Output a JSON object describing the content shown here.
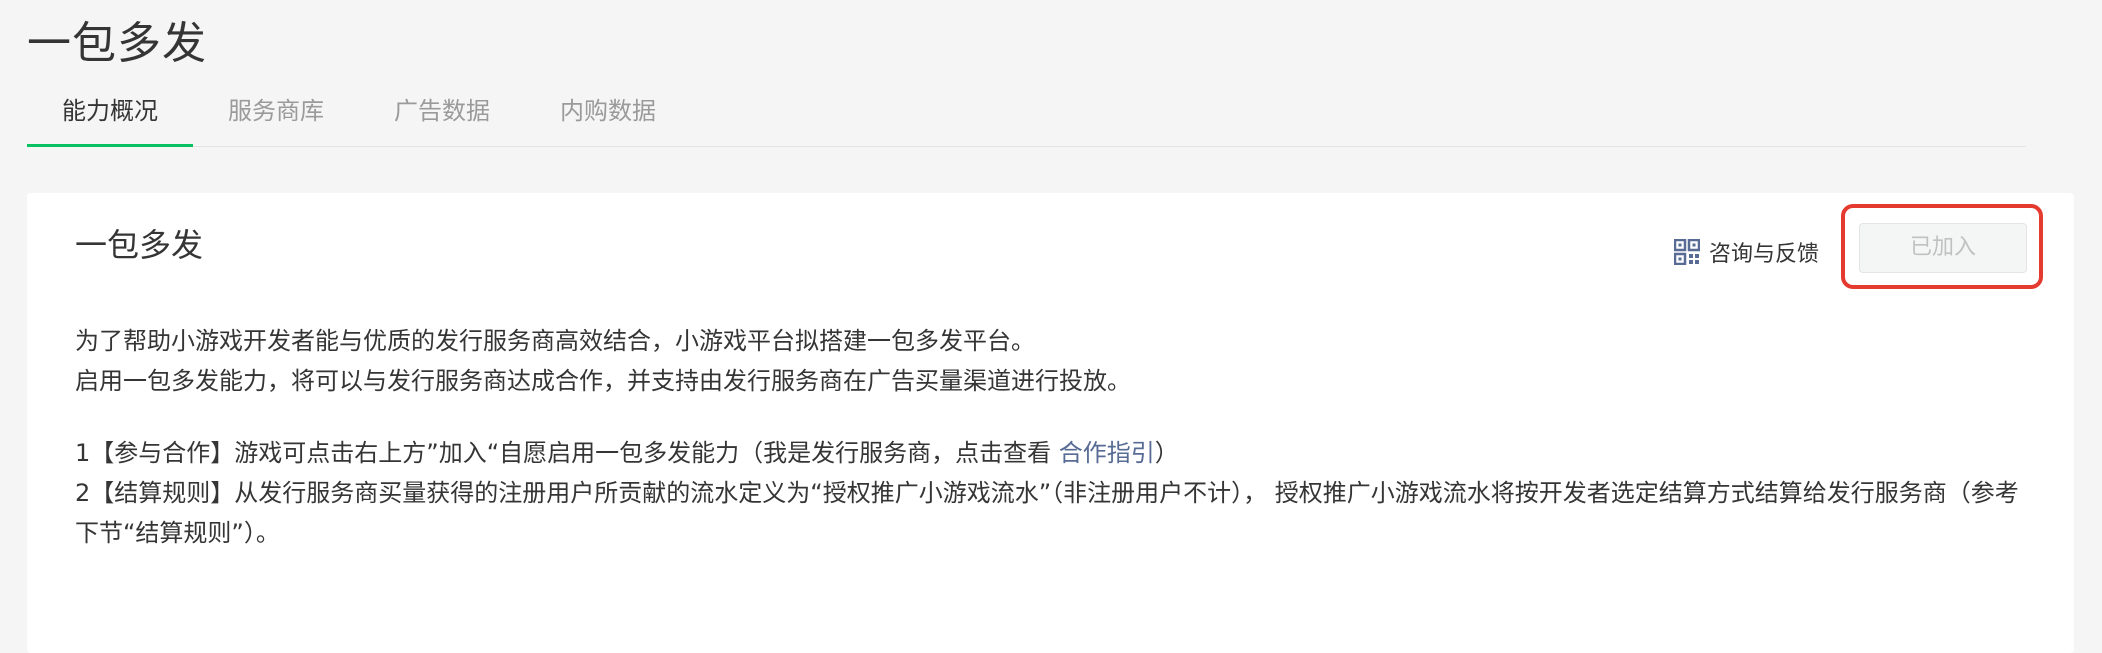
{
  "page": {
    "title": "一包多发"
  },
  "tabs": [
    {
      "label": "能力概况",
      "active": true
    },
    {
      "label": "服务商库",
      "active": false
    },
    {
      "label": "广告数据",
      "active": false
    },
    {
      "label": "内购数据",
      "active": false
    }
  ],
  "card": {
    "title": "一包多发",
    "feedback_label": "咨询与反馈",
    "feedback_icon": "qr-code-icon",
    "joined_button_label": "已加入",
    "intro_line1": "为了帮助小游戏开发者能与优质的发行服务商高效结合，小游戏平台拟搭建一包多发平台。",
    "intro_line2": "启用一包多发能力，将可以与发行服务商达成合作，并支持由发行服务商在广告买量渠道进行投放。",
    "rule1_text": "1【参与合作】游戏可点击右上方”加入“自愿启用一包多发能力（我是发行服务商，点击查看 ",
    "rule1_link": "合作指引",
    "rule1_end": "）",
    "rule2_text": "2【结算规则】从发行服务商买量获得的注册用户所贡献的流水定义为“授权推广小游戏流水”（非注册用户不计），  授权推广小游戏流水将按开发者选定结算方式结算给发行服务商（参考下节“结算规则”）。"
  },
  "colors": {
    "accent_green": "#07c160",
    "link_blue": "#576b95",
    "highlight_red": "#e53a2f"
  }
}
